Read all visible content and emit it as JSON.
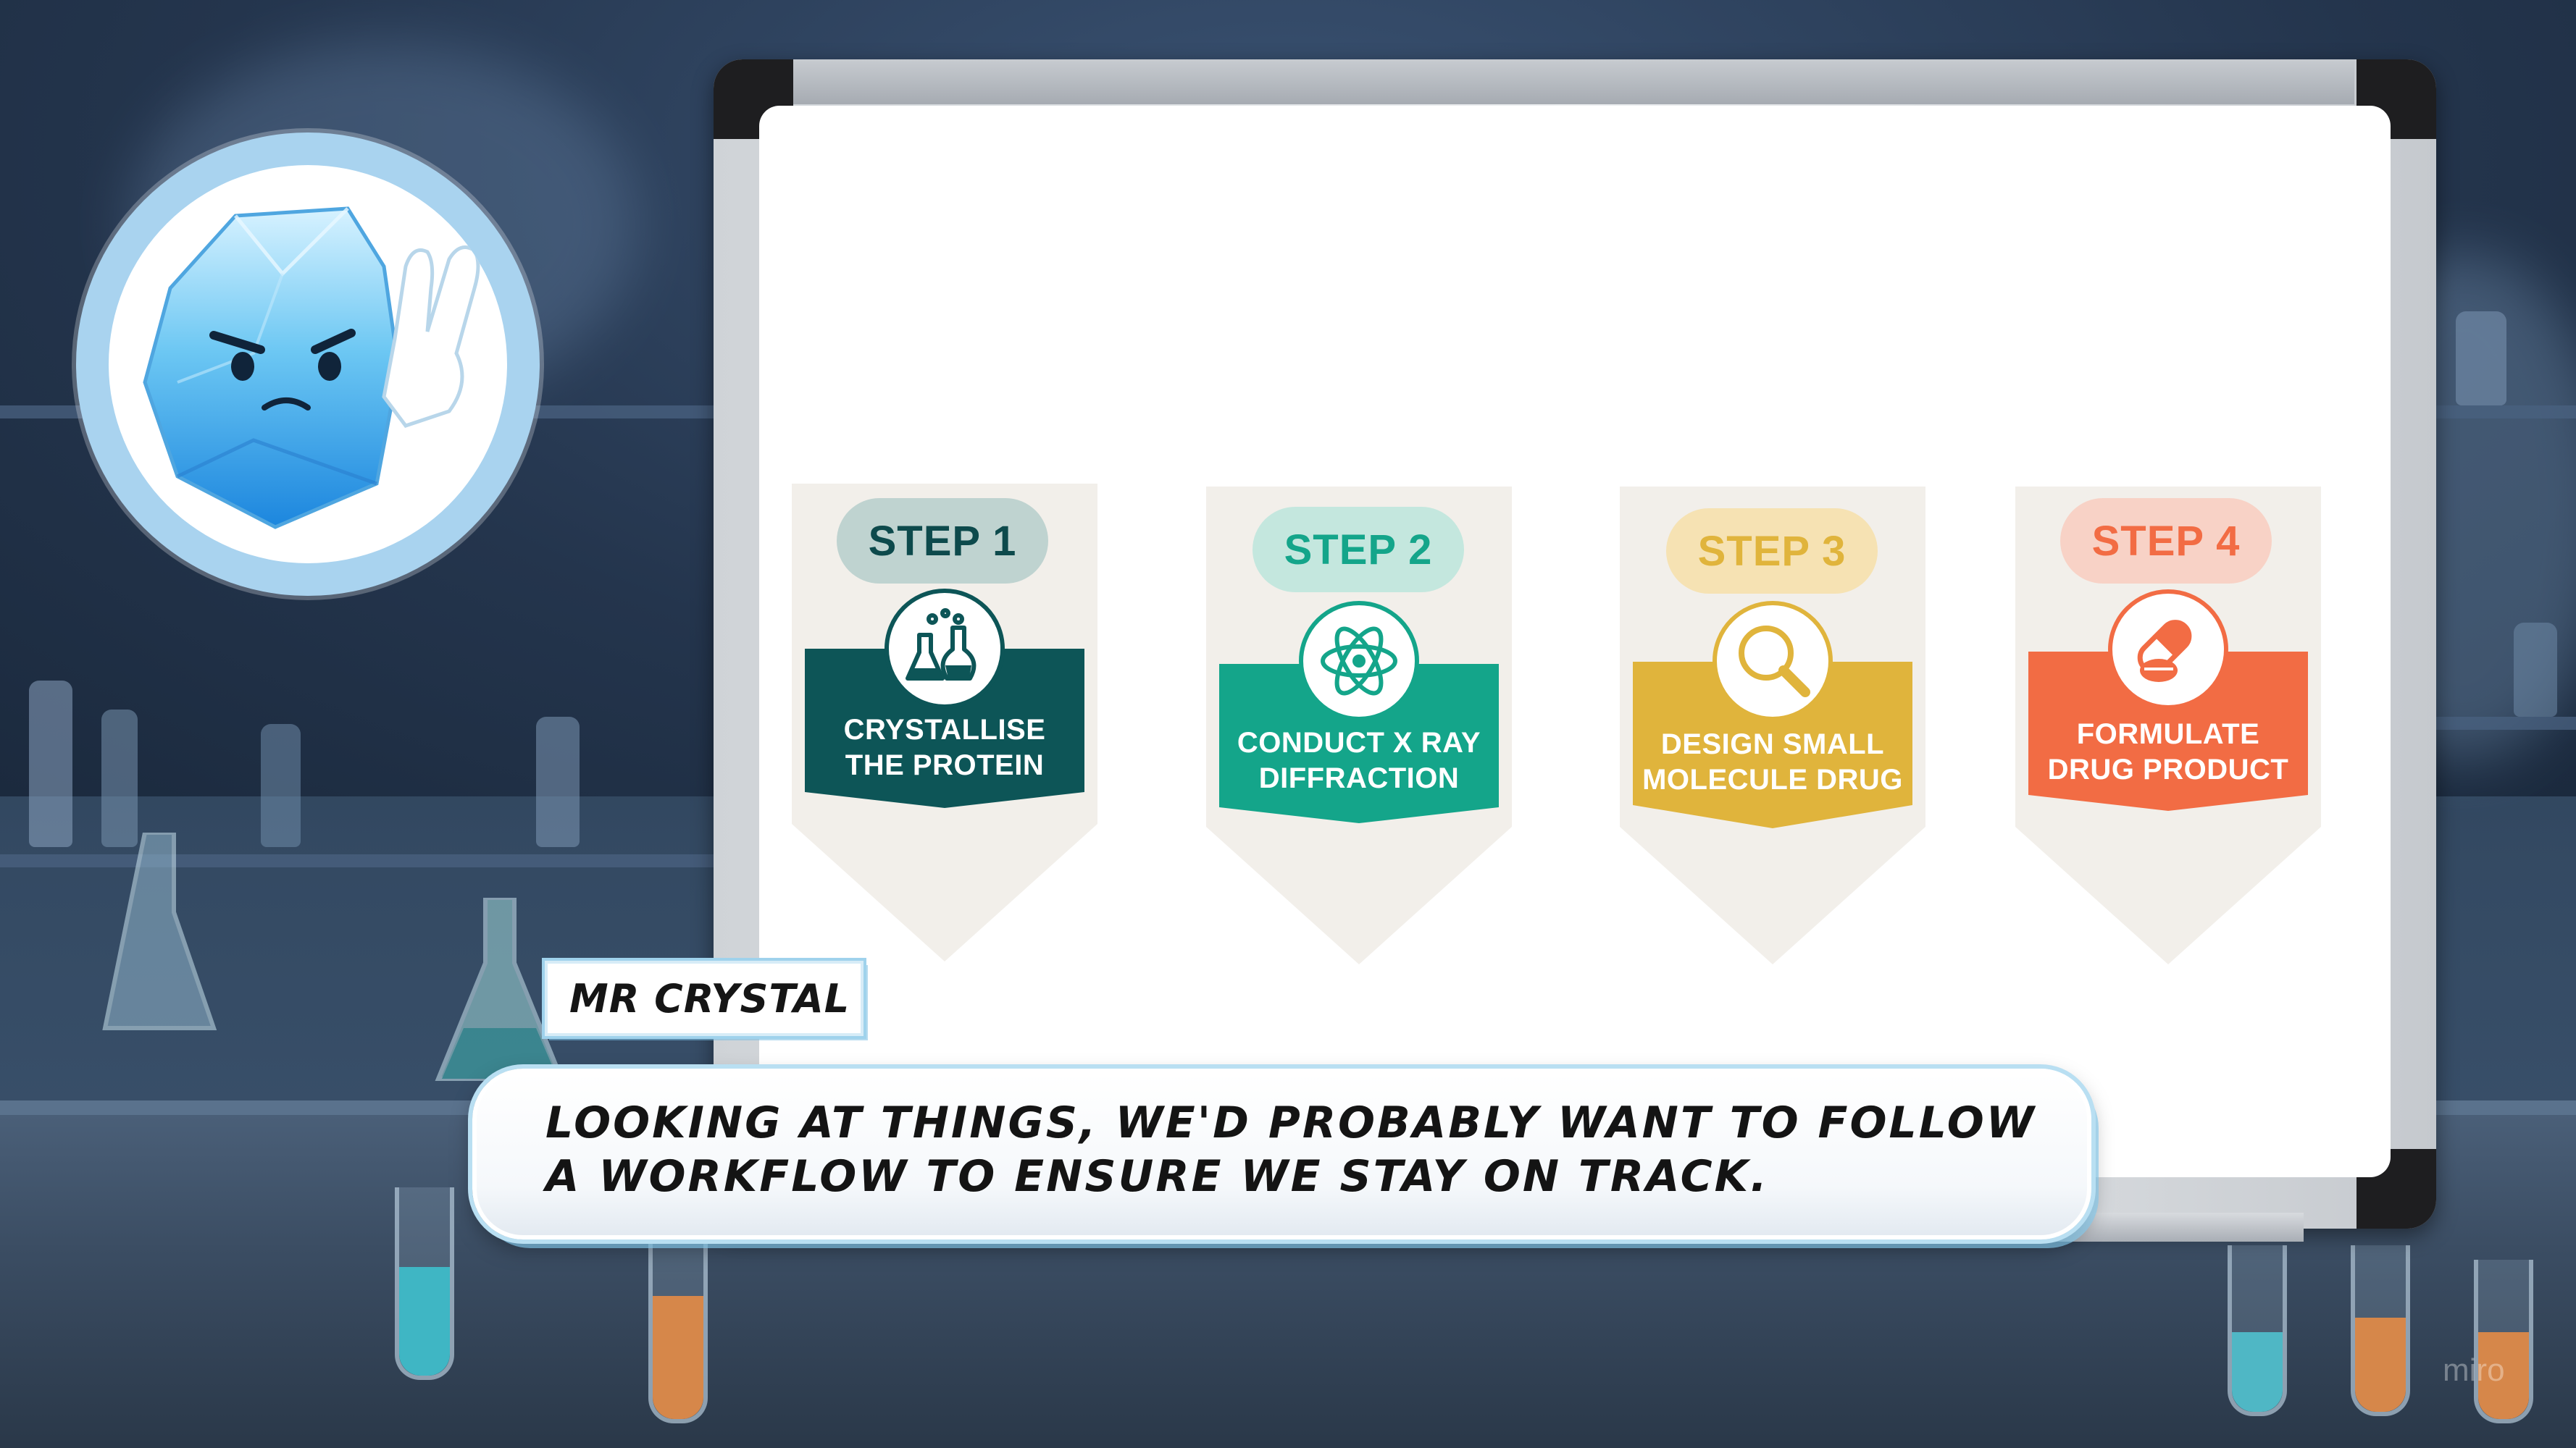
{
  "scene": {
    "speaker_name": "Mr Crystal",
    "dialogue": "Looking at things, we'd probably want to follow a workflow to ensure we stay on track.",
    "watermark": "miro"
  },
  "workflow": {
    "steps": [
      {
        "step_label": "STEP 1",
        "title_line1": "CRYSTALLISE",
        "title_line2": "THE PROTEIN",
        "icon": "lab-flasks-icon",
        "accent": "#0d5557",
        "pill_bg": "#bfd3d0",
        "pill_text": "#0d4a4c"
      },
      {
        "step_label": "STEP 2",
        "title_line1": "CONDUCT X RAY",
        "title_line2": "DIFFRACTION",
        "icon": "atom-icon",
        "accent": "#14a58a",
        "pill_bg": "#c4e7de",
        "pill_text": "#14a58a"
      },
      {
        "step_label": "STEP 3",
        "title_line1": "DESIGN SMALL",
        "title_line2": "MOLECULE DRUG",
        "icon": "magnifier-icon",
        "accent": "#e0b43c",
        "pill_bg": "#f6e2b3",
        "pill_text": "#e0b43c"
      },
      {
        "step_label": "STEP 4",
        "title_line1": "FORMULATE",
        "title_line2": "DRUG PRODUCT",
        "icon": "pills-icon",
        "accent": "#f26c44",
        "pill_bg": "#f8d2c6",
        "pill_text": "#f26c44"
      }
    ]
  }
}
